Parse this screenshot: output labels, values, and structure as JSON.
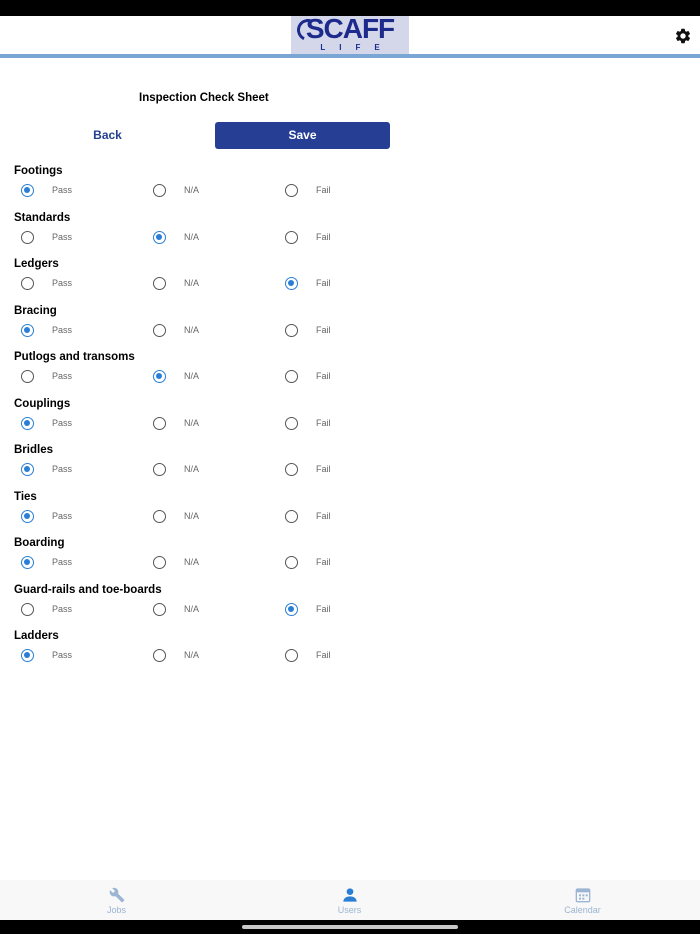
{
  "header": {
    "logo_text": "SCAFF",
    "logo_subtext": "LIFE",
    "settings_icon": "gear-icon"
  },
  "page": {
    "title": "Inspection Check Sheet",
    "back_label": "Back",
    "save_label": "Save"
  },
  "options": [
    "Pass",
    "N/A",
    "Fail"
  ],
  "sections": [
    {
      "title": "Footings",
      "selected": "Pass"
    },
    {
      "title": "Standards",
      "selected": "N/A"
    },
    {
      "title": "Ledgers",
      "selected": "Fail"
    },
    {
      "title": "Bracing",
      "selected": "Pass"
    },
    {
      "title": "Putlogs and transoms",
      "selected": "N/A"
    },
    {
      "title": "Couplings",
      "selected": "Pass"
    },
    {
      "title": "Bridles",
      "selected": "Pass"
    },
    {
      "title": "Ties",
      "selected": "Pass"
    },
    {
      "title": "Boarding",
      "selected": "Pass"
    },
    {
      "title": "Guard-rails and toe-boards",
      "selected": "Fail"
    },
    {
      "title": "Ladders",
      "selected": "Pass"
    }
  ],
  "tabs": [
    {
      "label": "Jobs",
      "icon": "wrench-icon"
    },
    {
      "label": "Users",
      "icon": "user-icon"
    },
    {
      "label": "Calendar",
      "icon": "calendar-icon"
    }
  ],
  "colors": {
    "accent": "#263f95",
    "radio_selected": "#2a7fd4",
    "tab_inactive": "#9bb5d3"
  }
}
